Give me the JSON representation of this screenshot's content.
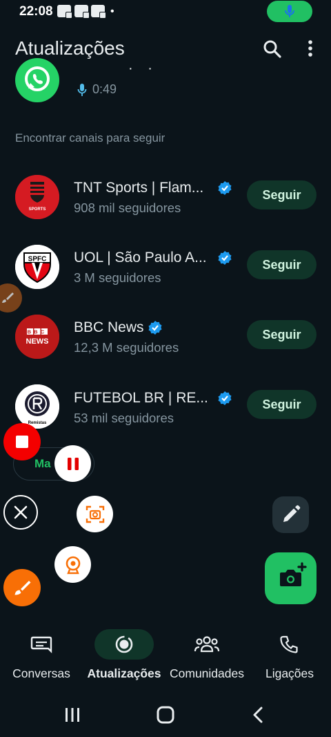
{
  "status_bar": {
    "time": "22:08",
    "dot": "•",
    "mic_icon": "mic-icon",
    "accent": "#21c063"
  },
  "header": {
    "title": "Atualizações",
    "search_icon": "search-icon",
    "menu_icon": "more-vert-icon"
  },
  "status_item": {
    "duration": "0:49",
    "dots": "· ·"
  },
  "channels_section": {
    "title": "Encontrar canais para seguir",
    "channels": [
      {
        "name": "TNT Sports | Flam...",
        "followers": "908 mil seguidores",
        "button": "Seguir"
      },
      {
        "name": "UOL | São Paulo A...",
        "followers": "3 M seguidores",
        "button": "Seguir"
      },
      {
        "name": "BBC News",
        "followers": "12,3 M seguidores",
        "button": "Seguir"
      },
      {
        "name": "FUTEBOL BR | RE...",
        "followers": "53 mil seguidores",
        "button": "Seguir"
      }
    ],
    "more_button": "Ma",
    "avatar_texts": {
      "spfc": "SPFC",
      "bbc1": "BBC",
      "bbc2": "NEWS",
      "tnt": "SPORTS",
      "remo": "Remistas"
    }
  },
  "bottom_nav": {
    "items": [
      {
        "label": "Conversas"
      },
      {
        "label": "Atualizações"
      },
      {
        "label": "Comunidades"
      },
      {
        "label": "Ligações"
      }
    ],
    "active": "Atualizações"
  },
  "colors": {
    "background": "#0b141a",
    "accent_green": "#21c063",
    "follow_bg": "#103529",
    "secondary_text": "#8696a0",
    "verified_blue": "#1d9bf0",
    "record_red": "#f40000",
    "brush_orange": "#f86f06"
  }
}
